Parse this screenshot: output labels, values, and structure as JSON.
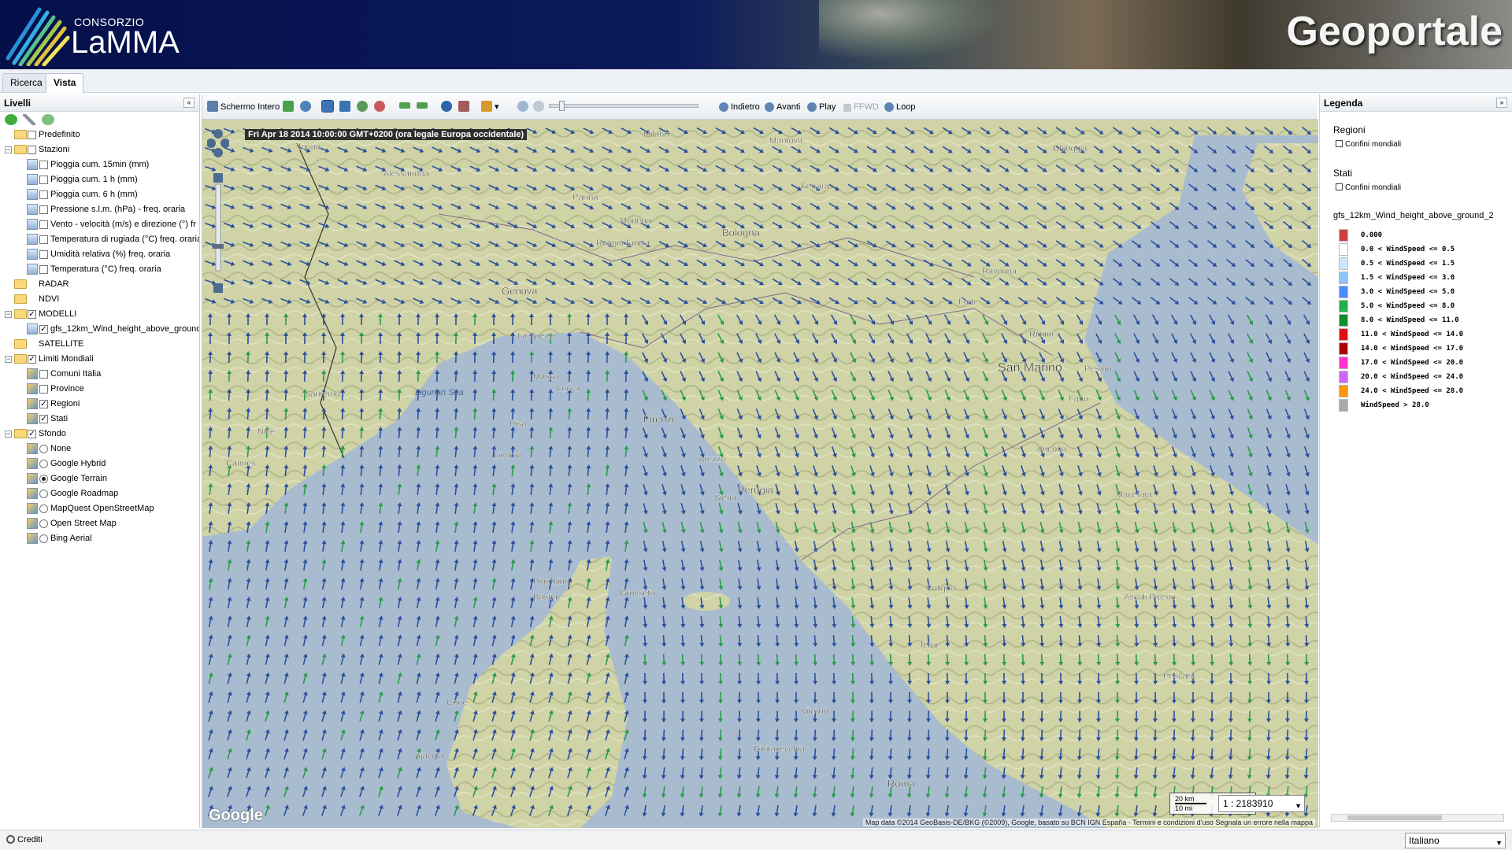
{
  "header": {
    "logo_small": "CONSORZIO",
    "logo_big": "LaMMA",
    "title": "Geoportale"
  },
  "tabs": [
    {
      "label": "Ricerca",
      "active": false
    },
    {
      "label": "Vista",
      "active": true
    }
  ],
  "left_panel": {
    "title": "Livelli",
    "tree": [
      {
        "label": "Predefinito",
        "level": 0,
        "kind": "folder",
        "checked": false
      },
      {
        "label": "Stazioni",
        "level": 0,
        "kind": "folder",
        "checked": false,
        "expanded": true
      },
      {
        "label": "Pioggia cum. 15min (mm)",
        "level": 1,
        "kind": "layer",
        "checked": false
      },
      {
        "label": "Pioggia cum. 1 h (mm)",
        "level": 1,
        "kind": "layer",
        "checked": false
      },
      {
        "label": "Pioggia cum. 6 h (mm)",
        "level": 1,
        "kind": "layer",
        "checked": false
      },
      {
        "label": "Pressione s.l.m. (hPa) - freq. oraria",
        "level": 1,
        "kind": "layer",
        "checked": false
      },
      {
        "label": "Vento - velocità (m/s) e direzione (°) fr",
        "level": 1,
        "kind": "layer",
        "checked": false
      },
      {
        "label": "Temperatura di rugiada (°C) freq. oraria",
        "level": 1,
        "kind": "layer",
        "checked": false
      },
      {
        "label": "Umidità relativa (%) freq. oraria",
        "level": 1,
        "kind": "layer",
        "checked": false
      },
      {
        "label": "Temperatura (°C) freq. oraria",
        "level": 1,
        "kind": "layer",
        "checked": false
      },
      {
        "label": "RADAR",
        "level": 0,
        "kind": "folder",
        "checked": null
      },
      {
        "label": "NDVI",
        "level": 0,
        "kind": "folder",
        "checked": null
      },
      {
        "label": "MODELLI",
        "level": 0,
        "kind": "folder",
        "checked": true,
        "expanded": true
      },
      {
        "label": "gfs_12km_Wind_height_above_ground",
        "level": 1,
        "kind": "layer",
        "checked": true
      },
      {
        "label": "SATELLITE",
        "level": 0,
        "kind": "folder",
        "checked": null
      },
      {
        "label": "Limiti Mondiali",
        "level": 0,
        "kind": "folder",
        "checked": true,
        "expanded": true
      },
      {
        "label": "Comuni Italia",
        "level": 1,
        "kind": "raster",
        "checked": false
      },
      {
        "label": "Province",
        "level": 1,
        "kind": "raster",
        "checked": false
      },
      {
        "label": "Regioni",
        "level": 1,
        "kind": "raster",
        "checked": true
      },
      {
        "label": "Stati",
        "level": 1,
        "kind": "raster",
        "checked": true
      },
      {
        "label": "Sfondo",
        "level": 0,
        "kind": "folder",
        "checked": true,
        "expanded": true
      },
      {
        "label": "None",
        "level": 1,
        "kind": "radio",
        "checked": false
      },
      {
        "label": "Google Hybrid",
        "level": 1,
        "kind": "radio",
        "checked": false
      },
      {
        "label": "Google Terrain",
        "level": 1,
        "kind": "radio",
        "checked": true
      },
      {
        "label": "Google Roadmap",
        "level": 1,
        "kind": "radio",
        "checked": false
      },
      {
        "label": "MapQuest OpenStreetMap",
        "level": 1,
        "kind": "radio",
        "checked": false
      },
      {
        "label": "Open Street Map",
        "level": 1,
        "kind": "radio",
        "checked": false
      },
      {
        "label": "Bing Aerial",
        "level": 1,
        "kind": "radio",
        "checked": false
      }
    ]
  },
  "map_toolbar": {
    "fullscreen": "Schermo Intero",
    "back": "Indietro",
    "forward": "Avanti",
    "play": "Play",
    "ffwd": "FFWD",
    "loop": "Loop"
  },
  "map": {
    "timestamp": "Fri Apr 18 2014 10:00:00 GMT+0200 (ora legale Europa occidentale)",
    "scale_top": "20 km",
    "scale_bottom": "10 mi",
    "scale_value": "1 : 2183910",
    "attribution": "Map data ©2014 GeoBasis-DE/BKG (©2009), Google, basato su BCN IGN España · Termini e condizioni d'uso   Segnala un errore nella mappa",
    "google_logo": "Google",
    "places": [
      {
        "name": "Torino"
      },
      {
        "name": "Milano"
      },
      {
        "name": "Alessandria"
      },
      {
        "name": "Parma"
      },
      {
        "name": "Modena"
      },
      {
        "name": "Bologna"
      },
      {
        "name": "Ferrara"
      },
      {
        "name": "Ravenna"
      },
      {
        "name": "Genova"
      },
      {
        "name": "La Spezia"
      },
      {
        "name": "Forlì"
      },
      {
        "name": "Rimini"
      },
      {
        "name": "San Marino"
      },
      {
        "name": "Pisa"
      },
      {
        "name": "Livorno"
      },
      {
        "name": "Firenze"
      },
      {
        "name": "Arezzo"
      },
      {
        "name": "Perugia"
      },
      {
        "name": "Ancona"
      },
      {
        "name": "Nice"
      },
      {
        "name": "Cannes"
      },
      {
        "name": "Sanremo"
      },
      {
        "name": "Grosseto"
      },
      {
        "name": "Piombino"
      },
      {
        "name": "Bastia"
      },
      {
        "name": "Corte"
      },
      {
        "name": "Ajaccio"
      },
      {
        "name": "Terni"
      },
      {
        "name": "Viterbo"
      },
      {
        "name": "Civitavecchia"
      },
      {
        "name": "Roma"
      },
      {
        "name": "Pescara"
      },
      {
        "name": "Ascoli Piceno"
      },
      {
        "name": "Macerata"
      },
      {
        "name": "Siena"
      },
      {
        "name": "Foligno"
      },
      {
        "name": "Ligurian Sea"
      },
      {
        "name": "Reggio Emilia"
      },
      {
        "name": "Mantova"
      },
      {
        "name": "Chioggia"
      },
      {
        "name": "Lucca"
      },
      {
        "name": "Massa"
      },
      {
        "name": "Fano"
      },
      {
        "name": "Pesaro"
      }
    ]
  },
  "legend": {
    "title": "Legenda",
    "sections": [
      {
        "title": "Regioni",
        "item": "Confini mondiali"
      },
      {
        "title": "Stati",
        "item": "Confini mondiali"
      }
    ],
    "layer_title": "gfs_12km_Wind_height_above_ground_2",
    "classes": [
      {
        "label": "0.000",
        "color": "#d04040"
      },
      {
        "label": "0.0 < WindSpeed <= 0.5",
        "color": "#ffffff"
      },
      {
        "label": "0.5 < WindSpeed <= 1.5",
        "color": "#cce6ff"
      },
      {
        "label": "1.5 < WindSpeed <= 3.0",
        "color": "#8ec5ff"
      },
      {
        "label": "3.0 < WindSpeed <= 5.0",
        "color": "#4a8cff"
      },
      {
        "label": "5.0 < WindSpeed <= 8.0",
        "color": "#22b14c"
      },
      {
        "label": "8.0 < WindSpeed <= 11.0",
        "color": "#0d8f2c"
      },
      {
        "label": "11.0 < WindSpeed <= 14.0",
        "color": "#e01010"
      },
      {
        "label": "14.0 < WindSpeed <= 17.0",
        "color": "#b00000"
      },
      {
        "label": "17.0 < WindSpeed <= 20.0",
        "color": "#ff33cc"
      },
      {
        "label": "20.0 < WindSpeed <= 24.0",
        "color": "#cc66ff"
      },
      {
        "label": "24.0 < WindSpeed <= 28.0",
        "color": "#ff9900"
      },
      {
        "label": "WindSpeed > 28.0",
        "color": "#aaaaaa"
      }
    ]
  },
  "status": {
    "credits": "Crediti",
    "language": "Italiano"
  }
}
